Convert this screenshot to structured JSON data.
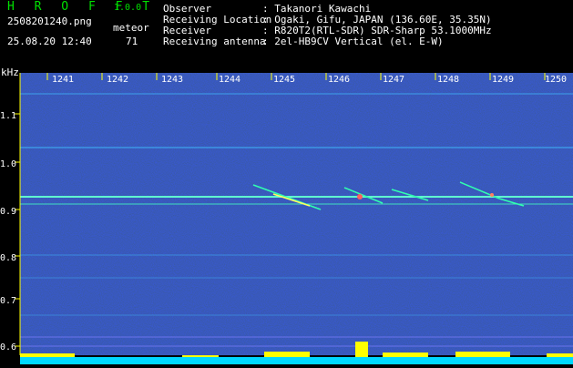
{
  "app": {
    "logo": "H R O F F T",
    "version": "1.0.0"
  },
  "file": {
    "name": "2508201240.png",
    "datetime": "25.08.20 12:40"
  },
  "meteor": {
    "label": "meteor",
    "count": "71"
  },
  "info": [
    {
      "label": "Observer",
      "value": ": Takanori Kawachi"
    },
    {
      "label": "Receiving Location",
      "value": ": Ogaki, Gifu, JAPAN (136.60E, 35.35N)"
    },
    {
      "label": "Receiver",
      "value": ": R820T2(RTL-SDR) SDR-Sharp 53.1000MHz"
    },
    {
      "label": "Receiving antenna",
      "value": ": 2el-HB9CV Vertical (el. E-W)"
    }
  ],
  "axis": {
    "y_unit": "kHz",
    "y_ticks": [
      "1.1",
      "1.0",
      "0.9",
      "0.8",
      "0.7",
      "0.6"
    ],
    "x_ticks": [
      "1241",
      "1242",
      "1243",
      "1244",
      "1245",
      "1246",
      "1247",
      "1248",
      "1249",
      "1250"
    ]
  },
  "colors": {
    "background": "#000000",
    "noise": "#1010a0",
    "tick": "#ffff00",
    "trace": "#00ffc0",
    "bar": "#00e0ff"
  }
}
